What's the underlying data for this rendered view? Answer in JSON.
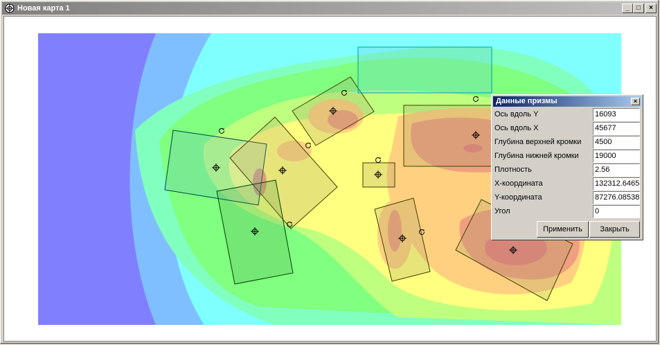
{
  "window": {
    "title": "Новая карта 1",
    "controls": {
      "minimize": "_",
      "maximize": "□",
      "close": "×"
    }
  },
  "dialog": {
    "title": "Данные призмы",
    "close_glyph": "×",
    "fields": [
      {
        "label": "Ось вдоль Y",
        "value": "16093"
      },
      {
        "label": "Ось вдоль X",
        "value": "45677"
      },
      {
        "label": "Глубина верхней кромки",
        "value": "4500"
      },
      {
        "label": "Глубина нижней кромки",
        "value": "19000"
      },
      {
        "label": "Плотность",
        "value": "2.56"
      },
      {
        "label": "X-координата",
        "value": "132312.6465"
      },
      {
        "label": "Y-координата",
        "value": "87276.08538"
      },
      {
        "label": "Угол",
        "value": "0"
      }
    ],
    "apply_label": "Применить",
    "close_label": "Закрыть"
  },
  "map": {
    "contour_colors": [
      "#8080ff",
      "#80bfff",
      "#80ffff",
      "#80ffbf",
      "#80ff80",
      "#bfff80",
      "#ffff80",
      "#ffd080",
      "#f0a080",
      "#e88080"
    ],
    "prism_count": 9,
    "icons": [
      "crosshair-icon",
      "rotate-icon"
    ]
  }
}
